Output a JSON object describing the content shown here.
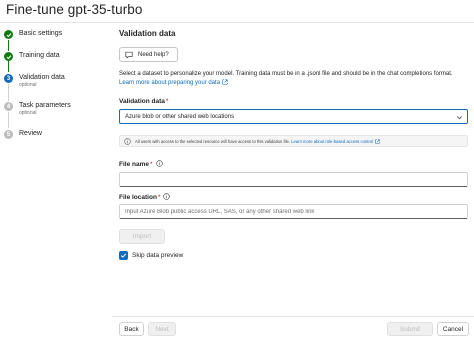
{
  "window": {
    "title": "Fine-tune gpt-35-turbo"
  },
  "steps": [
    {
      "label": "Basic settings",
      "status": "done"
    },
    {
      "label": "Training data",
      "status": "done"
    },
    {
      "label": "Validation data",
      "sub": "optional",
      "status": "current",
      "number": "3"
    },
    {
      "label": "Task parameters",
      "sub": "optional",
      "status": "todo",
      "number": "4"
    },
    {
      "label": "Review",
      "status": "todo",
      "number": "5"
    }
  ],
  "section": {
    "title": "Validation data"
  },
  "help_button": {
    "label": "Need help?"
  },
  "description": {
    "text": "Select a dataset to personalize your model. Training data must be in a .jsonl file and should be in the chat completions format.",
    "link": "Learn more about preparing your data"
  },
  "validation_select": {
    "label": "Validation data",
    "required_mark": "*",
    "value": "Azure blob or other shared web locations"
  },
  "notice": {
    "text": "All users with access to the selected resource will have access to this validation file.",
    "link": "Learn more about role-based access control"
  },
  "file_name": {
    "label": "File name",
    "required_mark": "*",
    "value": "",
    "placeholder": ""
  },
  "file_location": {
    "label": "File location",
    "required_mark": "*",
    "value": "",
    "placeholder": "Input Azure Blob public access URL, SAS, or any other shared web link"
  },
  "import_button": {
    "label": "Import"
  },
  "skip_preview": {
    "label": "Skip data preview",
    "checked": true
  },
  "footer": {
    "back": "Back",
    "next": "Next",
    "submit": "Submit",
    "cancel": "Cancel"
  },
  "colors": {
    "accent": "#0f6cbd",
    "success": "#107c10",
    "required": "#c50f1f"
  }
}
